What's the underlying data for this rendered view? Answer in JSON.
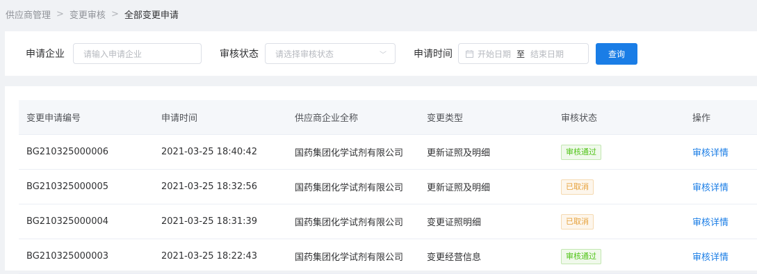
{
  "breadcrumb": {
    "items": [
      "供应商管理",
      "变更审核",
      "全部变更申请"
    ],
    "separator": ">"
  },
  "filters": {
    "company_label": "申请企业",
    "company_placeholder": "请输入申请企业",
    "status_label": "审核状态",
    "status_placeholder": "请选择审核状态",
    "time_label": "申请时间",
    "start_placeholder": "开始日期",
    "range_separator": "至",
    "end_placeholder": "结束日期",
    "query_label": "查询"
  },
  "table": {
    "columns": [
      "变更申请编号",
      "申请时间",
      "供应商企业全称",
      "变更类型",
      "审核状态",
      "操作"
    ],
    "rows": [
      {
        "id": "BG210325000006",
        "time": "2021-03-25 18:40:42",
        "company": "国药集团化学试剂有限公司",
        "type": "更新证照及明细",
        "status": "审核通过",
        "status_kind": "success",
        "action": "审核详情"
      },
      {
        "id": "BG210325000005",
        "time": "2021-03-25 18:32:56",
        "company": "国药集团化学试剂有限公司",
        "type": "更新证照及明细",
        "status": "已取消",
        "status_kind": "warning",
        "action": "审核详情"
      },
      {
        "id": "BG210325000004",
        "time": "2021-03-25 18:31:39",
        "company": "国药集团化学试剂有限公司",
        "type": "变更证照明细",
        "status": "已取消",
        "status_kind": "warning",
        "action": "审核详情"
      },
      {
        "id": "BG210325000003",
        "time": "2021-03-25 18:22:43",
        "company": "国药集团化学试剂有限公司",
        "type": "变更经营信息",
        "status": "审核通过",
        "status_kind": "success",
        "action": "审核详情"
      }
    ]
  },
  "colors": {
    "primary": "#1a7de6",
    "success_text": "#52c41a",
    "success_bg": "#f0f9eb",
    "success_border": "#c2e7b0",
    "warning_text": "#e6a23c",
    "warning_bg": "#fdf6ec",
    "warning_border": "#f5dab1"
  },
  "icons": {
    "calendar": "calendar-icon",
    "dropdown": "chevron-down-icon"
  }
}
